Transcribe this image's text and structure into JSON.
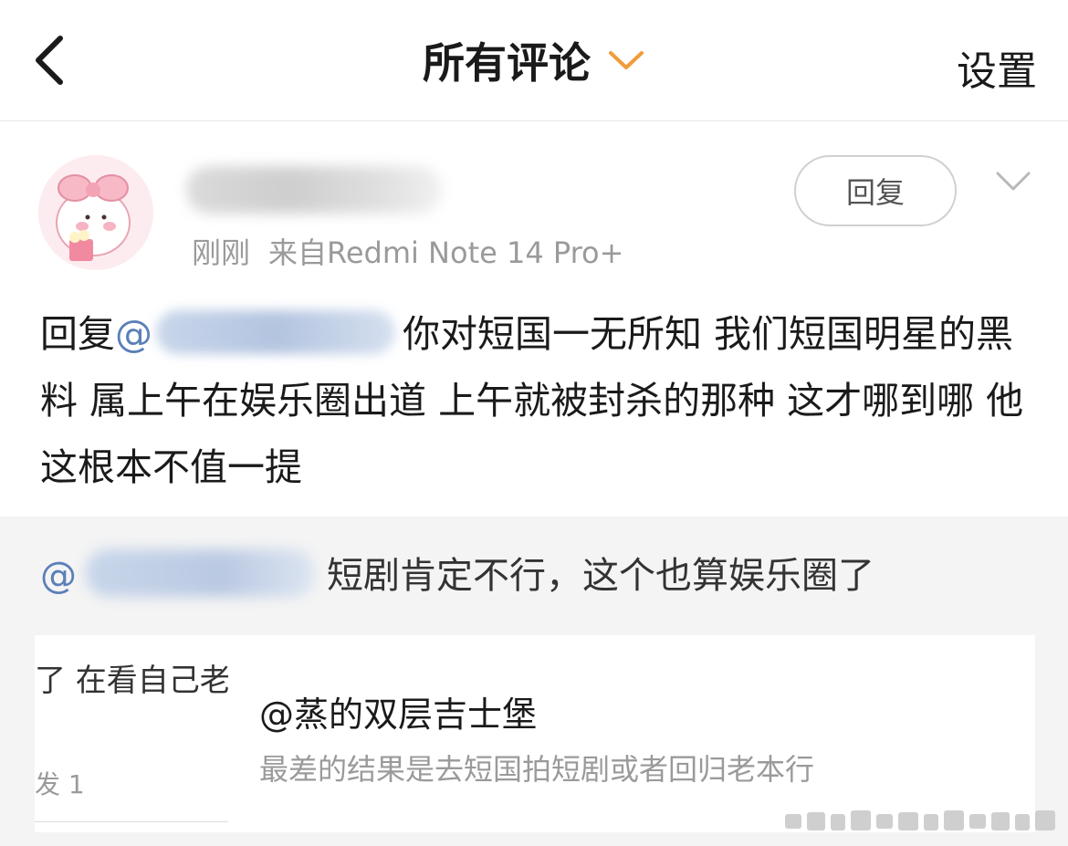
{
  "header": {
    "title": "所有评论",
    "settings_label": "设置"
  },
  "comment": {
    "time": "刚刚",
    "source": "来自Redmi Note 14 Pro+",
    "reply_button": "回复",
    "reply_prefix": "回复",
    "at_symbol": "@",
    "text": "你对短国一无所知 我们短国明星的黑料 属上午在娱乐圈出道 上午就被封杀的那种 这才哪到哪 他这根本不值一提"
  },
  "quoted": {
    "at_symbol": "@",
    "text": "短剧肯定不行，这个也算娱乐圈了"
  },
  "background_card": {
    "text": "了 在看自己老",
    "meta": "发 1"
  },
  "overlay": {
    "title": "@蒸的双层吉士堡",
    "subtitle": "最差的结果是去短国拍短剧或者回归老本行"
  },
  "colors": {
    "accent_orange": "#f29b38",
    "mention_blue": "#5b7fb8"
  }
}
